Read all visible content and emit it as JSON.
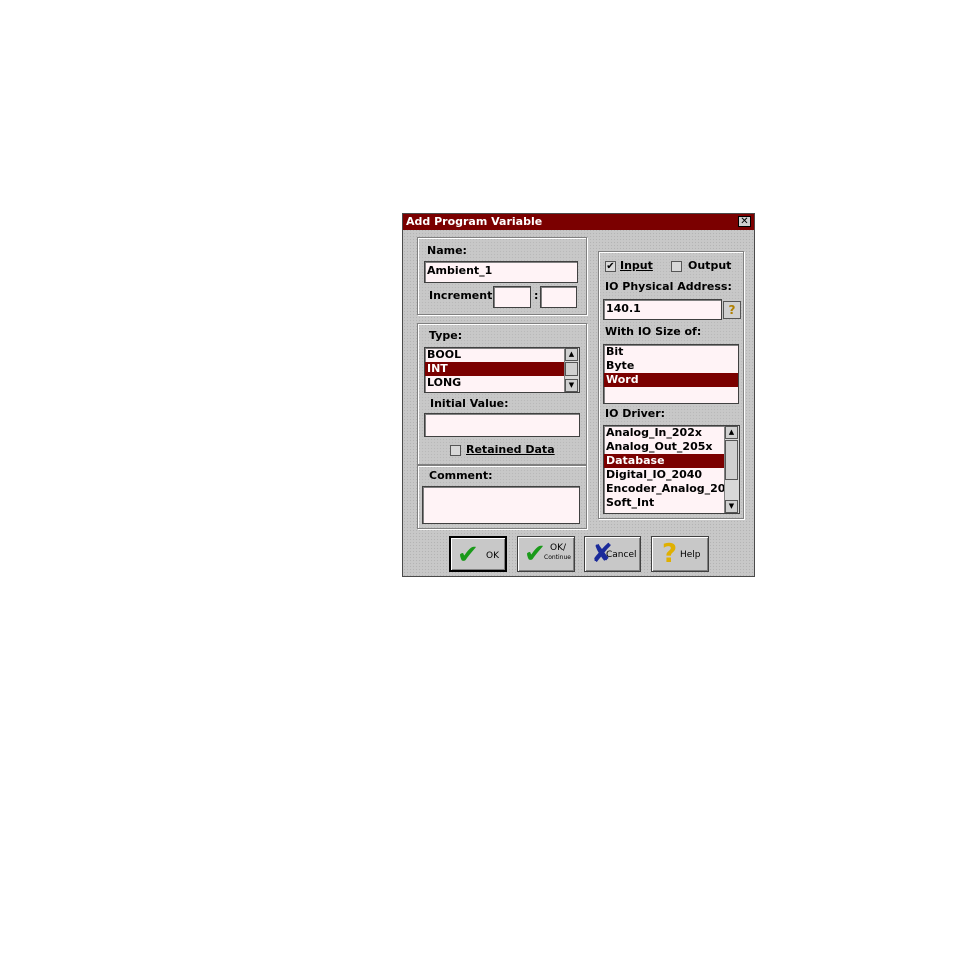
{
  "dialog": {
    "title": "Add Program Variable",
    "close_glyph": "✕"
  },
  "name_group": {
    "name_label": "Name:",
    "name_value": "Ambient_1",
    "increment_label": "Increment:",
    "increment_a": "",
    "increment_b": "",
    "separator": ":"
  },
  "type_group": {
    "type_label": "Type:",
    "types": [
      "BOOL",
      "INT",
      "LONG"
    ],
    "selected_type": "INT",
    "initial_value_label": "Initial Value:",
    "initial_value": "",
    "retained_label": "Retained Data",
    "retained_checked": false
  },
  "comment_group": {
    "comment_label": "Comment:",
    "comment_value": ""
  },
  "io_group": {
    "input_label": "Input",
    "input_checked": true,
    "output_label": "Output",
    "output_checked": false,
    "address_label": "IO Physical Address:",
    "address_value": "140.1",
    "address_help_glyph": "?",
    "size_label": "With IO Size of:",
    "sizes": [
      "Bit",
      "Byte",
      "Word"
    ],
    "selected_size": "Word",
    "driver_label": "IO Driver:",
    "drivers": [
      "Analog_In_202x",
      "Analog_Out_205x",
      "Database",
      "Digital_IO_2040",
      "Encoder_Analog_20",
      "Soft_Int"
    ],
    "selected_driver": "Database"
  },
  "buttons": {
    "ok": "OK",
    "ok_continue_line1": "OK/",
    "ok_continue_line2": "Continue",
    "cancel": "Cancel",
    "help": "Help"
  },
  "icons": {
    "check_glyph": "✔",
    "cross_glyph": "✘",
    "question_glyph": "?",
    "check_color": "#1a9a1a",
    "cross_color": "#1a2a9a",
    "question_color": "#e0b000"
  },
  "colors": {
    "selection": "#7b0000",
    "titlebar": "#7b0000"
  }
}
